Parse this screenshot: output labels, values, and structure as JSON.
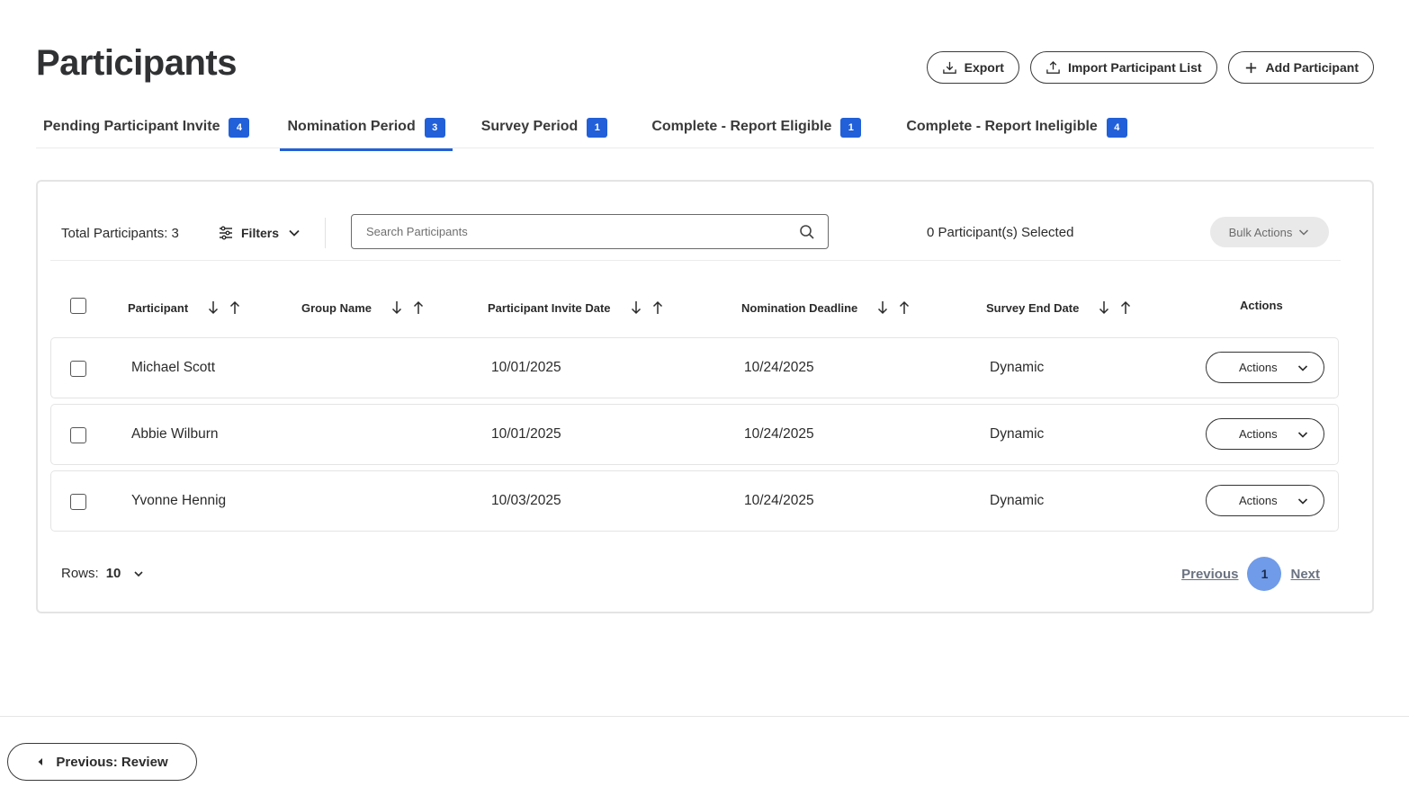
{
  "header": {
    "title": "Participants",
    "export_label": "Export",
    "import_label": "Import Participant List",
    "add_label": "Add Participant"
  },
  "tabs": [
    {
      "label": "Pending Participant Invite",
      "count": "4"
    },
    {
      "label": "Nomination Period",
      "count": "3",
      "active": true
    },
    {
      "label": "Survey Period",
      "count": "1"
    },
    {
      "label": "Complete - Report Eligible",
      "count": "1"
    },
    {
      "label": "Complete - Report Ineligible",
      "count": "4"
    }
  ],
  "toolbar": {
    "total": "Total Participants: 3",
    "filters_label": "Filters",
    "search_placeholder": "Search Participants",
    "selected": "0 Participant(s) Selected",
    "bulk_label": "Bulk Actions"
  },
  "table": {
    "columns": [
      "Participant",
      "Group Name",
      "Participant Invite Date",
      "Nomination Deadline",
      "Survey End Date",
      "Actions"
    ],
    "rows": [
      {
        "participant": "Michael Scott",
        "group": "",
        "invite_date": "10/01/2025",
        "deadline": "10/24/2025",
        "survey_end": "Dynamic",
        "action_label": "Actions"
      },
      {
        "participant": "Abbie Wilburn",
        "group": "",
        "invite_date": "10/01/2025",
        "deadline": "10/24/2025",
        "survey_end": "Dynamic",
        "action_label": "Actions"
      },
      {
        "participant": "Yvonne Hennig",
        "group": "",
        "invite_date": "10/03/2025",
        "deadline": "10/24/2025",
        "survey_end": "Dynamic",
        "action_label": "Actions"
      }
    ]
  },
  "pagination": {
    "rows_label": "Rows:",
    "rows_value": "10",
    "previous": "Previous",
    "current_page": "1",
    "next": "Next"
  },
  "footer": {
    "prev_review": "Previous: Review"
  },
  "colors": {
    "accent": "#2160d8",
    "page_active": "#6f9be8"
  }
}
